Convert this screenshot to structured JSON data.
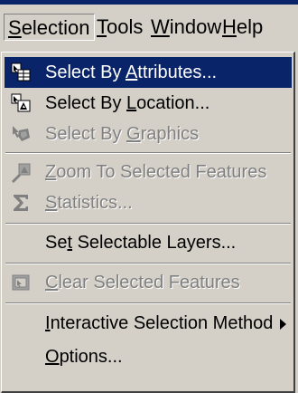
{
  "menubar": {
    "items": [
      {
        "label": "Selection",
        "accel": "S",
        "rest": "election"
      },
      {
        "label": "Tools",
        "accel": "T",
        "rest": "ools"
      },
      {
        "label": "Window",
        "accel": "W",
        "rest": "indow"
      },
      {
        "label": "Help",
        "accel": "H",
        "rest": "elp"
      }
    ]
  },
  "menu": {
    "items": [
      {
        "label": "Select By Attributes...",
        "pre": "Select By ",
        "accel": "A",
        "post": "ttributes...",
        "icon": "select-by-attributes-icon",
        "state": "highlighted"
      },
      {
        "label": "Select By Location...",
        "pre": "Select By ",
        "accel": "L",
        "post": "ocation...",
        "icon": "select-by-location-icon",
        "state": "enabled"
      },
      {
        "label": "Select By Graphics",
        "pre": "Select By ",
        "accel": "G",
        "post": "raphics",
        "icon": "select-by-graphics-icon",
        "state": "disabled"
      },
      {
        "label": "Zoom To Selected Features",
        "pre": "",
        "accel": "Z",
        "post": "oom To Selected Features",
        "icon": "zoom-to-selected-icon",
        "state": "disabled"
      },
      {
        "label": "Statistics...",
        "pre": "",
        "accel": "S",
        "post": "tatistics...",
        "icon": "sigma-icon",
        "state": "disabled"
      },
      {
        "label": "Set Selectable Layers...",
        "pre": "Se",
        "accel": "t",
        "post": " Selectable Layers...",
        "icon": "",
        "state": "enabled"
      },
      {
        "label": "Clear Selected Features",
        "pre": "",
        "accel": "C",
        "post": "lear Selected Features",
        "icon": "clear-selection-icon",
        "state": "disabled"
      },
      {
        "label": "Interactive Selection Method",
        "pre": "",
        "accel": "I",
        "post": "nteractive Selection Method",
        "icon": "",
        "state": "enabled",
        "submenu": true
      },
      {
        "label": "Options...",
        "pre": "",
        "accel": "O",
        "post": "ptions...",
        "icon": "",
        "state": "enabled"
      }
    ]
  },
  "colors": {
    "highlight": "#0a246a",
    "menu_bg": "#d4d0c8",
    "disabled_text": "#808080"
  }
}
